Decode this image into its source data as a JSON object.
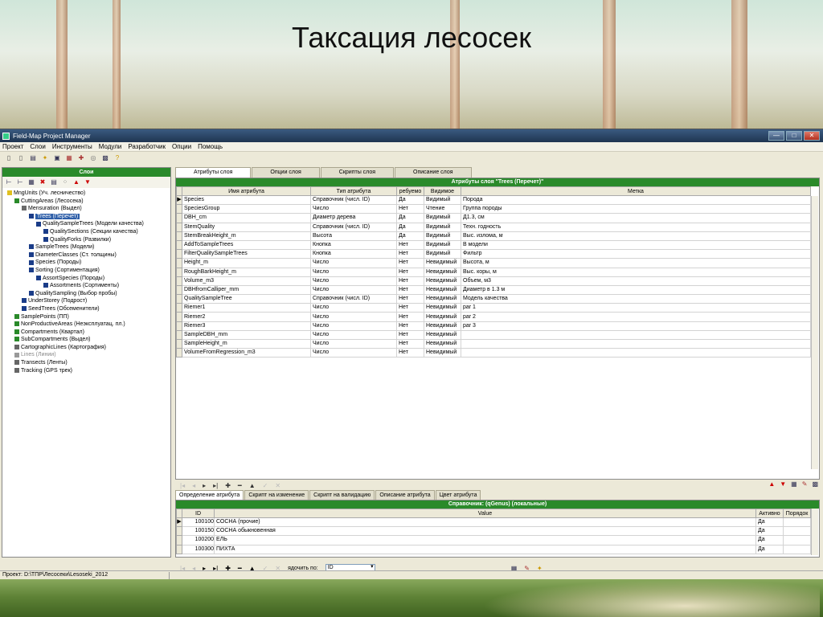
{
  "slide": {
    "title": "Таксация лесосек"
  },
  "window": {
    "title": "Field-Map Project Manager",
    "buttons": {
      "minimize": "—",
      "maximize": "□",
      "close": "✕"
    }
  },
  "menu": [
    "Проект",
    "Слои",
    "Инструменты",
    "Модули",
    "Разработчик",
    "Опции",
    "Помощь"
  ],
  "toolbar_icons": [
    "new-icon",
    "open-icon",
    "print-icon",
    "wand-icon",
    "copy-icon",
    "layers-icon",
    "tools-icon",
    "target-icon",
    "export-icon",
    "help-icon"
  ],
  "left_panel": {
    "header": "Слои",
    "tree": [
      {
        "label": "MngUnits (Уч. лесничество)",
        "level": 0,
        "color": "#e0c020"
      },
      {
        "label": "CuttingAreas (Лесосека)",
        "level": 1,
        "color": "#2a8a2a"
      },
      {
        "label": "Mensuration (Выдел)",
        "level": 2,
        "color": "#6a6a6a"
      },
      {
        "label": "Trees (Перечет)",
        "level": 3,
        "color": "#1a3c88",
        "selected": true
      },
      {
        "label": "QualitySampleTrees (Модели качества)",
        "level": 4,
        "color": "#1a3c88"
      },
      {
        "label": "QualitySections (Секции качества)",
        "level": 5,
        "color": "#1a3c88"
      },
      {
        "label": "QualityForks (Развилки)",
        "level": 5,
        "color": "#1a3c88"
      },
      {
        "label": "SampleTrees (Модели)",
        "level": 3,
        "color": "#1a3c88"
      },
      {
        "label": "DiameterClasses (Ст. толщины)",
        "level": 3,
        "color": "#1a3c88"
      },
      {
        "label": "Species (Породы)",
        "level": 3,
        "color": "#1a3c88"
      },
      {
        "label": "Sorting (Сортиментация)",
        "level": 3,
        "color": "#1a3c88"
      },
      {
        "label": "AssortSpecies (Породы)",
        "level": 4,
        "color": "#1a3c88"
      },
      {
        "label": "Assortments (Сортименты)",
        "level": 5,
        "color": "#1a3c88"
      },
      {
        "label": "QualitySampling (Выбор пробы)",
        "level": 3,
        "color": "#1a3c88"
      },
      {
        "label": "UnderStorey (Подрост)",
        "level": 2,
        "color": "#1a3c88"
      },
      {
        "label": "SeedTrees (Обсеменители)",
        "level": 2,
        "color": "#1a3c88"
      },
      {
        "label": "SamplePoints (ПП)",
        "level": 1,
        "color": "#2a8a2a"
      },
      {
        "label": "NonProductiveAreas (Неэксплуатац. пл.)",
        "level": 1,
        "color": "#2a8a2a"
      },
      {
        "label": "Compartments (Квартал)",
        "level": 1,
        "color": "#2a8a2a"
      },
      {
        "label": "SubCompartments (Выдел)",
        "level": 1,
        "color": "#2a8a2a"
      },
      {
        "label": "CartographicLines (Картография)",
        "level": 1,
        "color": "#666"
      },
      {
        "label": "Lines (Линии)",
        "level": 1,
        "color": "#999",
        "grey": true
      },
      {
        "label": "Transects (Ленты)",
        "level": 1,
        "color": "#666"
      },
      {
        "label": "Tracking (GPS трек)",
        "level": 1,
        "color": "#666"
      }
    ]
  },
  "status_bar": {
    "text": "Проект: D:\\ТПР\\Лесосеки\\Lesoseki_2012"
  },
  "top_tabs": [
    "Атрибуты слоя",
    "Опции слоя",
    "Скрипты слоя",
    "Описание слоя"
  ],
  "attr_grid": {
    "title": "Атрибуты слоя \"Trees (Перечет)\"",
    "columns": [
      "Имя атрибута",
      "Тип атрибута",
      "ребуемо",
      "Видимое",
      "Метка"
    ],
    "rows": [
      [
        "Species",
        "Справочник (числ. ID)",
        "Да",
        "Видимый",
        "Порода"
      ],
      [
        "SpeciesGroup",
        "Число",
        "Нет",
        "Чтение",
        "Группа породы"
      ],
      [
        "DBH_cm",
        "Диаметр дерева",
        "Да",
        "Видимый",
        "Д1.3, см"
      ],
      [
        "StemQuality",
        "Справочник (числ. ID)",
        "Да",
        "Видимый",
        "Техн. годность"
      ],
      [
        "StemBreakHeight_m",
        "Высота",
        "Да",
        "Видимый",
        "Выс. излома, м"
      ],
      [
        "AddToSampleTrees",
        "Кнопка",
        "Нет",
        "Видимый",
        "В модели"
      ],
      [
        "FilterQualitySampleTrees",
        "Кнопка",
        "Нет",
        "Видимый",
        "Фильтр"
      ],
      [
        "Height_m",
        "Число",
        "Нет",
        "Невидимый",
        "Высота, м"
      ],
      [
        "RoughBarkHeight_m",
        "Число",
        "Нет",
        "Невидимый",
        "Выс. коры, м"
      ],
      [
        "Volume_m3",
        "Число",
        "Нет",
        "Невидимый",
        "Объем, м3"
      ],
      [
        "DBHfromCalliper_mm",
        "Число",
        "Нет",
        "Невидимый",
        "Диаметр в 1.3 м"
      ],
      [
        "QualitySampleTree",
        "Справочник (числ. ID)",
        "Нет",
        "Невидимый",
        "Модель качества"
      ],
      [
        "Riemer1",
        "Число",
        "Нет",
        "Невидимый",
        "par 1"
      ],
      [
        "Riemer2",
        "Число",
        "Нет",
        "Невидимый",
        "par 2"
      ],
      [
        "Riemer3",
        "Число",
        "Нет",
        "Невидимый",
        "par 3"
      ],
      [
        "SampleDBH_mm",
        "Число",
        "Нет",
        "Невидимый",
        ""
      ],
      [
        "SampleHeight_m",
        "Число",
        "Нет",
        "Невидимый",
        ""
      ],
      [
        "VolumeFromRegression_m3",
        "Число",
        "Нет",
        "Невидимый",
        ""
      ]
    ]
  },
  "bottom_tabs": [
    "Определение атрибута",
    "Скрипт на изменение",
    "Скрипт на валидацию",
    "Описание атрибута",
    "Цвет атрибута"
  ],
  "dict_grid": {
    "title": "Справочник: (qGenus) (локальные)",
    "columns": [
      "ID",
      "Value",
      "Активно",
      "Порядок"
    ],
    "rows": [
      [
        "100100",
        "СОСНА (прочие)",
        "Да",
        ""
      ],
      [
        "100150",
        "СОСНА обыкновенная",
        "Да",
        ""
      ],
      [
        "100200",
        "ЕЛЬ",
        "Да",
        ""
      ],
      [
        "100300",
        "ПИХТА",
        "Да",
        ""
      ]
    ]
  },
  "sort": {
    "label": "ядочить по:",
    "value": "ID"
  }
}
